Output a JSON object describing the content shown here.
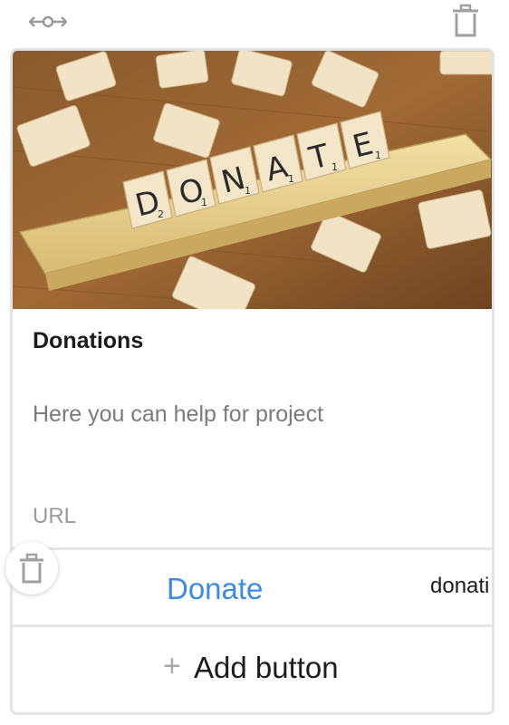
{
  "card": {
    "title": "Donations",
    "description": "Here you can help for project",
    "url_placeholder": "URL",
    "image_tiles": [
      "D",
      "O",
      "N",
      "A",
      "T",
      "E"
    ],
    "image_tile_scores": [
      "2",
      "1",
      "1",
      "1",
      "1",
      "1"
    ]
  },
  "buttons": [
    {
      "label": "Donate",
      "url": "donati"
    }
  ],
  "add_button": {
    "plus": "+",
    "label": "Add button"
  },
  "icons": {
    "drag": "drag-handle-icon",
    "delete": "trash-icon"
  }
}
